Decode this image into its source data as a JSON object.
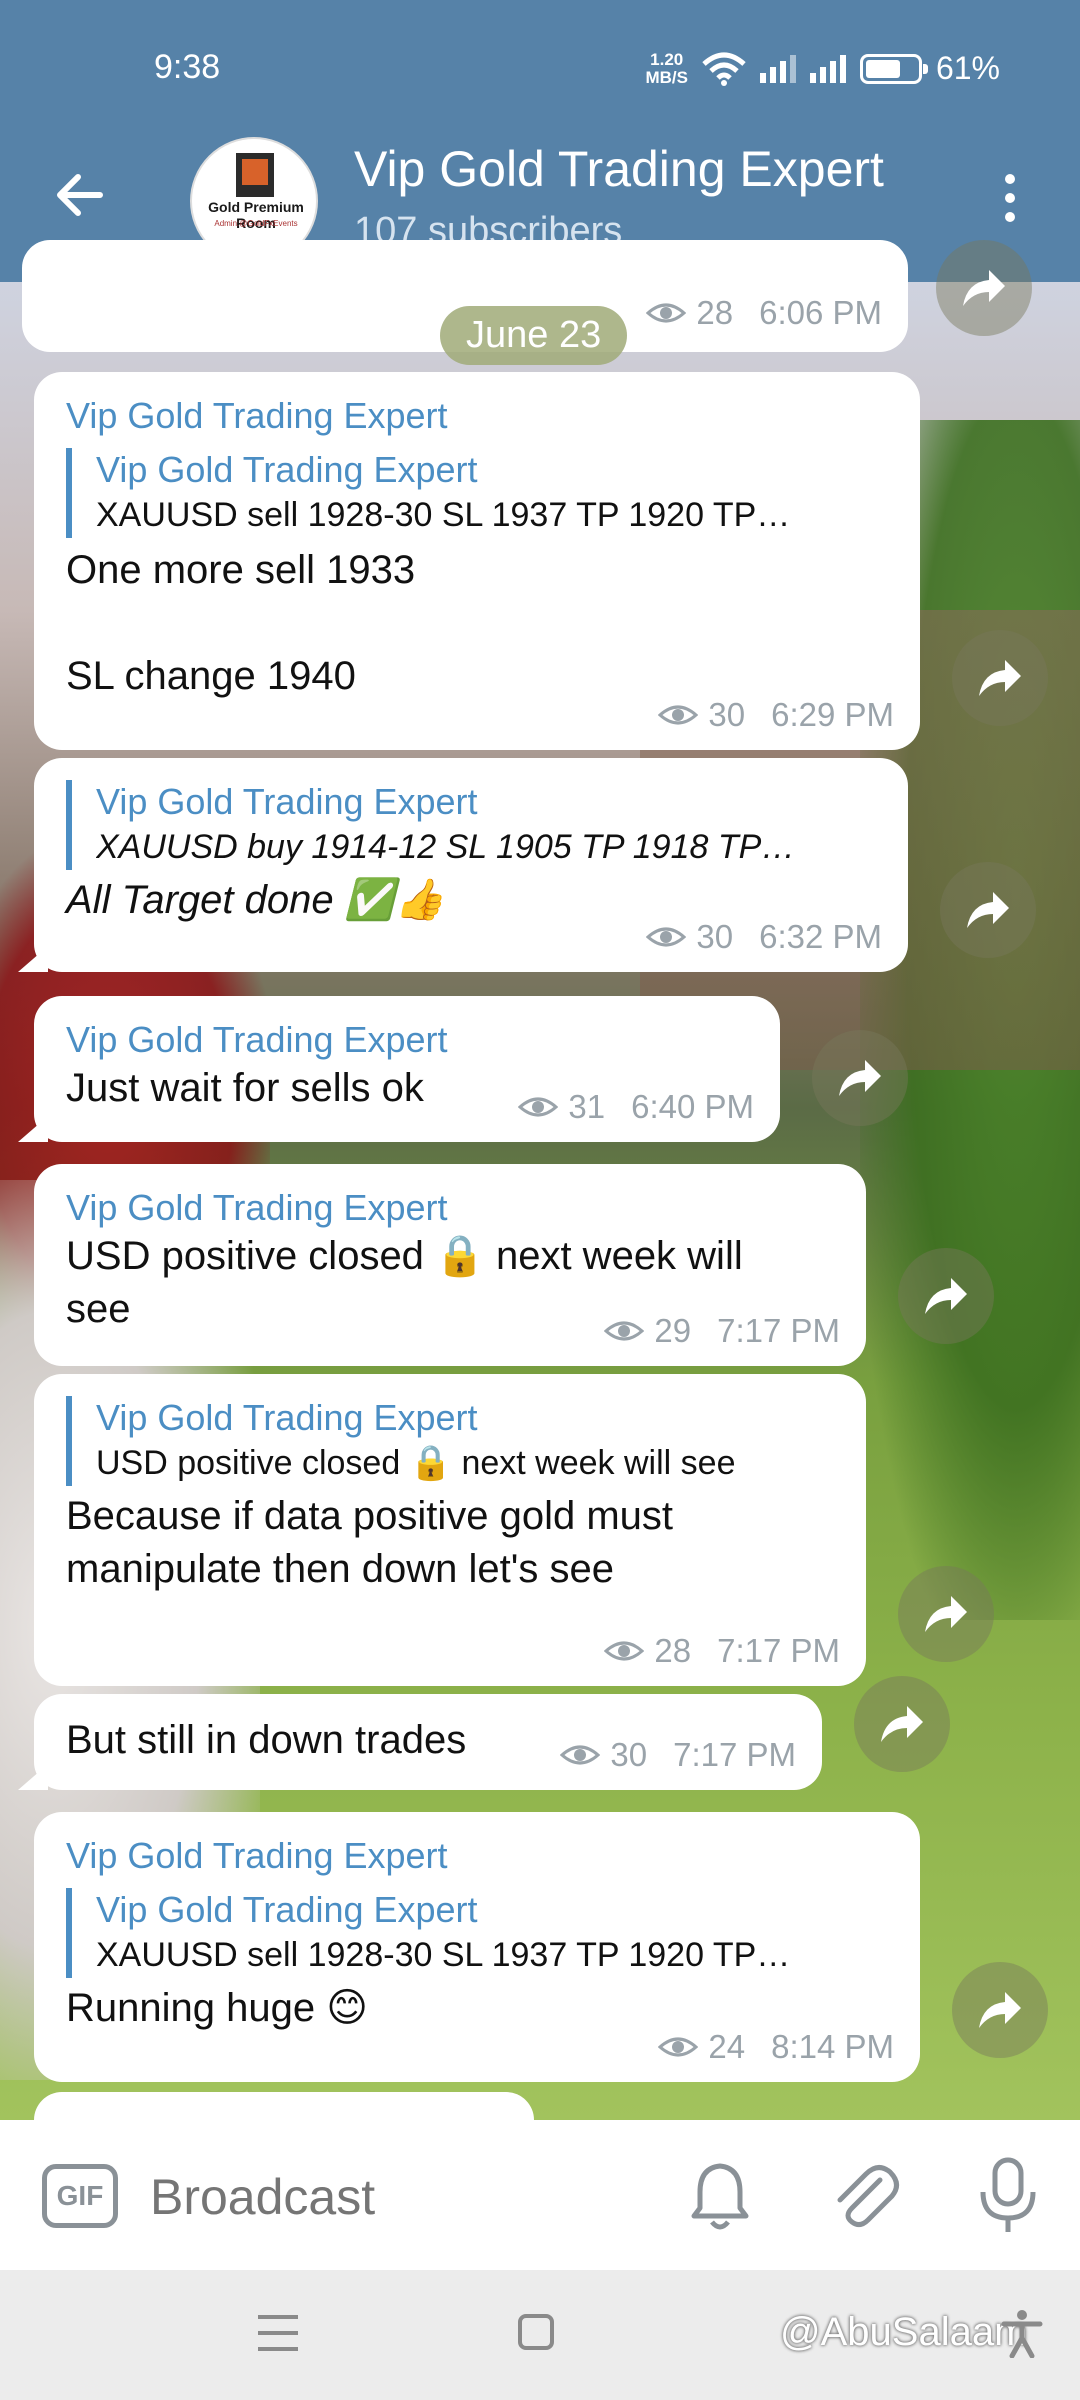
{
  "status_bar": {
    "time": "9:38",
    "net_speed_value": "1.20",
    "net_speed_unit": "MB/S",
    "battery": "61%"
  },
  "header": {
    "back_icon": "arrow-left-icon",
    "channel_name": "Vip Gold Trading Expert",
    "subscribers": "107 subscribers",
    "avatar_text": "Gold Premium Room",
    "avatar_subtext": "Admin:@GoldFxEvents",
    "more_icon": "more-vertical-icon"
  },
  "date_chip": "June 23",
  "messages": [
    {
      "views": "28",
      "time": "6:06 PM"
    },
    {
      "sender": "Vip Gold Trading Expert",
      "reply_name": "Vip Gold Trading Expert",
      "reply_text": "XAUUSD sell 1928-30 SL 1937  TP 1920 TP…",
      "text_1": "One more sell 1933",
      "text_2": "SL change 1940",
      "views": "30",
      "time": "6:29 PM"
    },
    {
      "reply_name": "Vip Gold Trading Expert",
      "reply_text": "XAUUSD buy 1914-12  SL 1905  TP 1918 TP…",
      "text": "All Target done ✅👍",
      "views": "30",
      "time": "6:32 PM"
    },
    {
      "sender": "Vip Gold Trading Expert",
      "text": "Just wait for sells ok",
      "views": "31",
      "time": "6:40 PM"
    },
    {
      "sender": "Vip Gold Trading Expert",
      "text_1": "USD positive closed 🔒 next week will",
      "text_2": "see",
      "views": "29",
      "time": "7:17 PM"
    },
    {
      "reply_name": "Vip Gold Trading Expert",
      "reply_text": "USD positive closed 🔒 next week will see",
      "text_1": "Because if data positive gold must",
      "text_2": "manipulate then down let's see",
      "views": "28",
      "time": "7:17 PM"
    },
    {
      "text": "But still in down trades",
      "views": "30",
      "time": "7:17 PM"
    },
    {
      "sender": "Vip Gold Trading Expert",
      "reply_name": "Vip Gold Trading Expert",
      "reply_text": "XAUUSD sell 1928-30 SL 1937  TP 1920 TP…",
      "text": "Running huge 😊",
      "views": "24",
      "time": "8:14 PM"
    }
  ],
  "input_bar": {
    "gif_label": "GIF",
    "placeholder": "Broadcast",
    "bell_icon": "bell-icon",
    "attach_icon": "paperclip-icon",
    "mic_icon": "microphone-icon"
  },
  "nav_bar": {
    "watermark": "@AbuSalaam"
  },
  "colors": {
    "header_bg": "#5682a8",
    "accent": "#4b8ec4",
    "meta_gray": "#9aa3aa"
  }
}
